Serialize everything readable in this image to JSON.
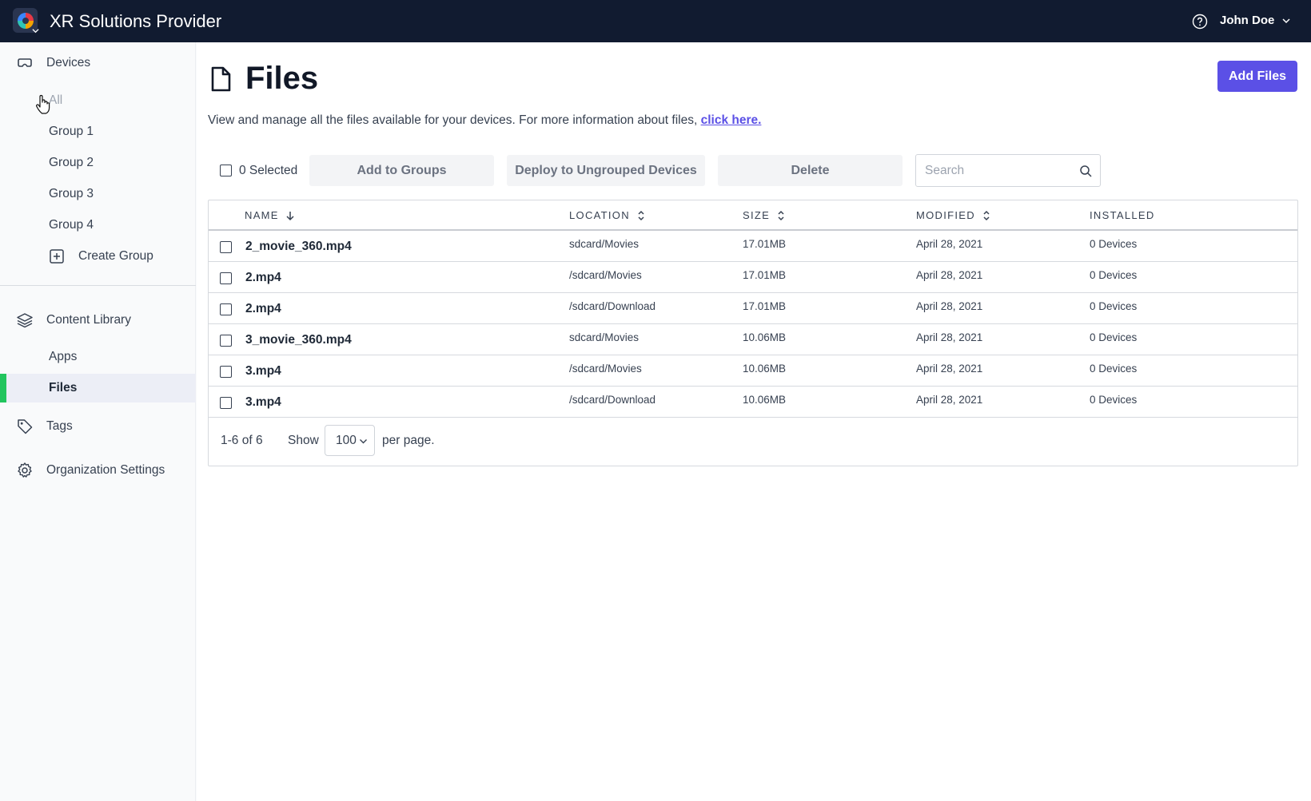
{
  "app": {
    "title": "XR Solutions Provider",
    "user_name": "John Doe"
  },
  "sidebar": {
    "devices": {
      "label": "Devices",
      "items": [
        "All",
        "Group 1",
        "Group 2",
        "Group 3",
        "Group 4"
      ],
      "create_group": "Create Group"
    },
    "content_library": {
      "label": "Content Library",
      "items": [
        "Apps",
        "Files"
      ],
      "active": "Files"
    },
    "tags": "Tags",
    "org_settings": "Organization Settings"
  },
  "page": {
    "title": "Files",
    "add_button": "Add Files",
    "description": "View and manage all the files available for your devices. For more information about files, ",
    "description_link": "click here."
  },
  "toolbar": {
    "selected": "0 Selected",
    "add_to_groups": "Add to Groups",
    "deploy": "Deploy to Ungrouped Devices",
    "delete": "Delete",
    "search_placeholder": "Search"
  },
  "table": {
    "columns": [
      "NAME",
      "LOCATION",
      "SIZE",
      "MODIFIED",
      "INSTALLED"
    ],
    "rows": [
      {
        "name": "2_movie_360.mp4",
        "location": "sdcard/Movies",
        "size": "17.01MB",
        "modified": "April 28, 2021",
        "installed": "0 Devices"
      },
      {
        "name": "2.mp4",
        "location": "/sdcard/Movies",
        "size": "17.01MB",
        "modified": "April 28, 2021",
        "installed": "0 Devices"
      },
      {
        "name": "2.mp4",
        "location": "/sdcard/Download",
        "size": "17.01MB",
        "modified": "April 28, 2021",
        "installed": "0 Devices"
      },
      {
        "name": "3_movie_360.mp4",
        "location": "sdcard/Movies",
        "size": "10.06MB",
        "modified": "April 28, 2021",
        "installed": "0 Devices"
      },
      {
        "name": "3.mp4",
        "location": "/sdcard/Movies",
        "size": "10.06MB",
        "modified": "April 28, 2021",
        "installed": "0 Devices"
      },
      {
        "name": "3.mp4",
        "location": "/sdcard/Download",
        "size": "10.06MB",
        "modified": "April 28, 2021",
        "installed": "0 Devices"
      }
    ]
  },
  "pagination": {
    "range": "1-6 of 6",
    "show_label": "Show",
    "per_page_value": "100",
    "per_page_label": "per page."
  },
  "colors": {
    "topbar": "#111b30",
    "accent": "#5b50e6",
    "active_marker": "#22c55e"
  }
}
